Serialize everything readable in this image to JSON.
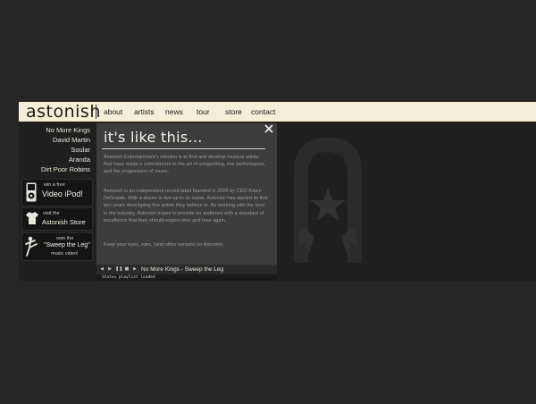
{
  "header": {
    "logo": "astonish",
    "nav": [
      {
        "label": "about"
      },
      {
        "label": "artists"
      },
      {
        "label": "news"
      },
      {
        "label": "tour"
      },
      {
        "label": "store"
      },
      {
        "label": "contact"
      }
    ]
  },
  "sidebar": {
    "artists": [
      "No More Kings",
      "David Martin",
      "Soular",
      "Aranda",
      "Dirt Poor Robins"
    ],
    "promos": [
      {
        "small": "win a free",
        "big": "Video iPod!",
        "icon": "ipod-icon"
      },
      {
        "small": "visit the",
        "big": "Astonish Store",
        "icon": "tshirt-icon"
      },
      {
        "small": "own the",
        "big": "\"Sweep the Leg\"",
        "small2": "music video!",
        "icon": "kick-figure-icon"
      }
    ]
  },
  "panel": {
    "title": "it's like this...",
    "paragraphs": [
      "Astonish Entertainment's mission is to find and develop musical artists that have made a commitment to the art of songwriting, live performance, and the progression of music.",
      "Astonish is an independent record label founded in 2005 by CEO Adam DeGraide. With a desire to live up to its name, Astonish has started its first two years developing five artists they believe in. By working with the best in the industry, Astonish hopes to provide an audience with a standard of excellence that they should expect time and time again.",
      "Keep your eyes, ears, (and other senses) on Astonish."
    ]
  },
  "player": {
    "track": "No More Kings - Sweep the Leg",
    "status": "Status playlist loaded"
  },
  "colors": {
    "background": "#262626",
    "nav_bg": "#f4efd6",
    "panel_bg": "#3d3d3d"
  }
}
